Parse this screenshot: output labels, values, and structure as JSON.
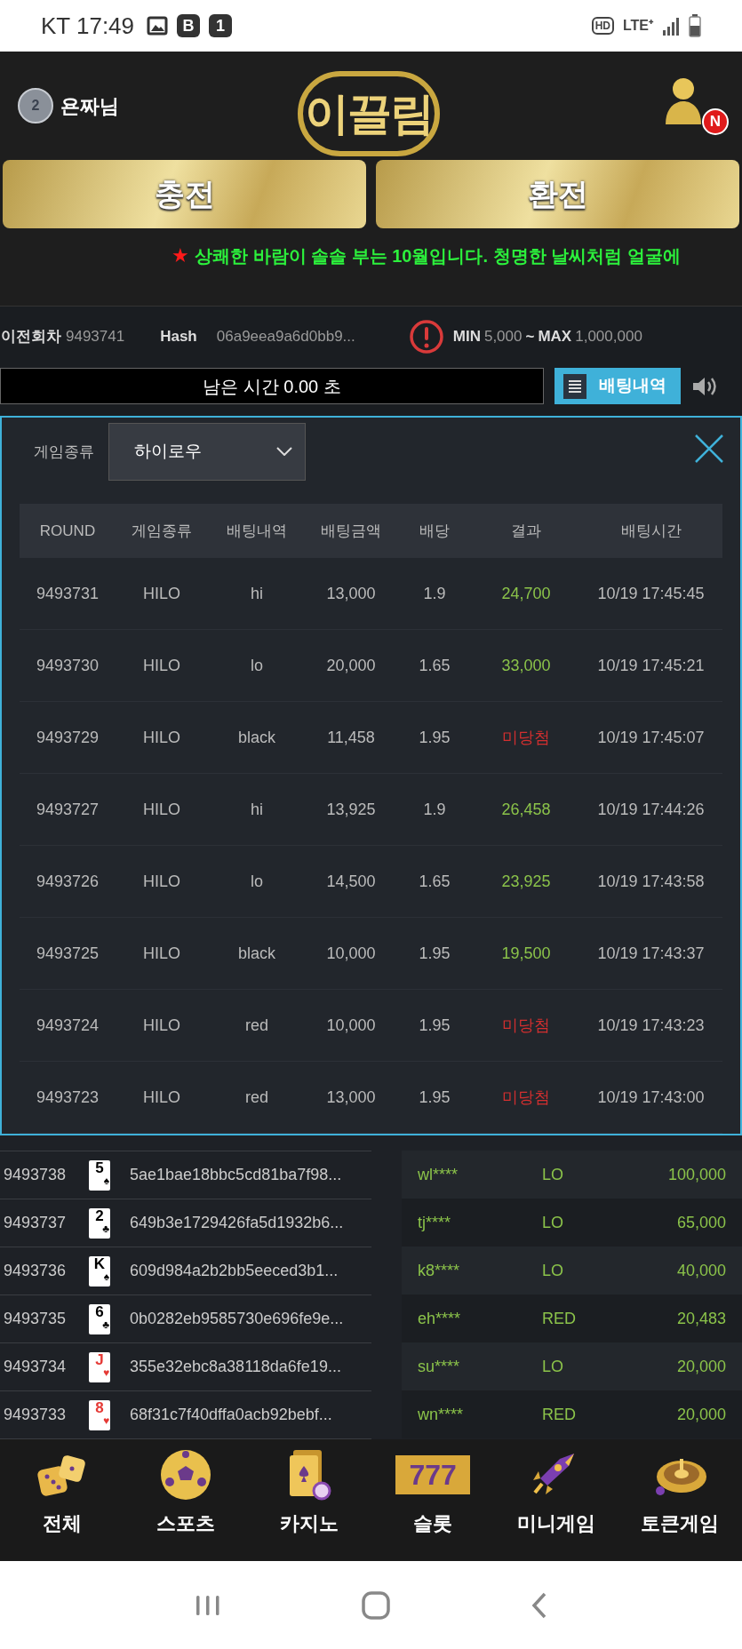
{
  "status_bar": {
    "carrier_time": "KT 17:49",
    "notification_badges": [
      "B",
      "1"
    ],
    "network": "HD",
    "signal_type": "LTE⁺"
  },
  "header": {
    "rank_badge": "2",
    "username": "욘짜님",
    "logo": "이끌림",
    "avatar_badge": "N"
  },
  "actions": [
    "충전",
    "환전"
  ],
  "marquee": {
    "star": "★",
    "text": "상쾌한 바람이 솔솔 부는 10월입니다. 청명한 날씨처럼 얼굴에"
  },
  "info": {
    "prev_label": "이전회차",
    "prev_round": "9493741",
    "hash_label": "Hash",
    "hash": "06a9eea9a6d0bb9...",
    "min_label": "MIN",
    "min": "5,000",
    "sep": "~",
    "max_label": "MAX",
    "max": "1,000,000"
  },
  "timer": "남은 시간 0.00 초",
  "history_button": "배팅내역",
  "modal": {
    "filter_label": "게임종류",
    "filter_value": "하이로우",
    "columns": [
      "ROUND",
      "게임종류",
      "배팅내역",
      "배팅금액",
      "배당",
      "결과",
      "배팅시간"
    ],
    "rows": [
      {
        "round": "9493731",
        "game": "HILO",
        "bet": "hi",
        "amount": "13,000",
        "odds": "1.9",
        "result": "24,700",
        "win": true,
        "time": "10/19 17:45:45"
      },
      {
        "round": "9493730",
        "game": "HILO",
        "bet": "lo",
        "amount": "20,000",
        "odds": "1.65",
        "result": "33,000",
        "win": true,
        "time": "10/19 17:45:21"
      },
      {
        "round": "9493729",
        "game": "HILO",
        "bet": "black",
        "amount": "11,458",
        "odds": "1.95",
        "result": "미당첨",
        "win": false,
        "time": "10/19 17:45:07"
      },
      {
        "round": "9493727",
        "game": "HILO",
        "bet": "hi",
        "amount": "13,925",
        "odds": "1.9",
        "result": "26,458",
        "win": true,
        "time": "10/19 17:44:26"
      },
      {
        "round": "9493726",
        "game": "HILO",
        "bet": "lo",
        "amount": "14,500",
        "odds": "1.65",
        "result": "23,925",
        "win": true,
        "time": "10/19 17:43:58"
      },
      {
        "round": "9493725",
        "game": "HILO",
        "bet": "black",
        "amount": "10,000",
        "odds": "1.95",
        "result": "19,500",
        "win": true,
        "time": "10/19 17:43:37"
      },
      {
        "round": "9493724",
        "game": "HILO",
        "bet": "red",
        "amount": "10,000",
        "odds": "1.95",
        "result": "미당첨",
        "win": false,
        "time": "10/19 17:43:23"
      },
      {
        "round": "9493723",
        "game": "HILO",
        "bet": "red",
        "amount": "13,000",
        "odds": "1.95",
        "result": "미당첨",
        "win": false,
        "time": "10/19 17:43:00"
      }
    ]
  },
  "rounds": [
    {
      "round": "9493738",
      "rank": "5",
      "suit": "♠",
      "color": "#000000",
      "hash": "5ae1bae18bbc5cd81ba7f98..."
    },
    {
      "round": "9493737",
      "rank": "2",
      "suit": "♣",
      "color": "#000000",
      "hash": "649b3e1729426fa5d1932b6..."
    },
    {
      "round": "9493736",
      "rank": "K",
      "suit": "♠",
      "color": "#000000",
      "hash": "609d984a2b2bb5eeced3b1..."
    },
    {
      "round": "9493735",
      "rank": "6",
      "suit": "♣",
      "color": "#000000",
      "hash": "0b0282eb9585730e696fe9e..."
    },
    {
      "round": "9493734",
      "rank": "J",
      "suit": "♥",
      "color": "#e53935",
      "hash": "355e32ebc8a38118da6fe19..."
    },
    {
      "round": "9493733",
      "rank": "8",
      "suit": "♥",
      "color": "#e53935",
      "hash": "68f31c7f40dffa0acb92bebf..."
    }
  ],
  "live_bets": [
    {
      "user": "wl****",
      "pick": "LO",
      "amount": "100,000"
    },
    {
      "user": "tj****",
      "pick": "LO",
      "amount": "65,000"
    },
    {
      "user": "k8****",
      "pick": "LO",
      "amount": "40,000"
    },
    {
      "user": "eh****",
      "pick": "RED",
      "amount": "20,483"
    },
    {
      "user": "su****",
      "pick": "LO",
      "amount": "20,000"
    },
    {
      "user": "wn****",
      "pick": "RED",
      "amount": "20,000"
    }
  ],
  "nav": [
    {
      "kind": "dice",
      "label": "전체"
    },
    {
      "kind": "ball",
      "label": "스포츠"
    },
    {
      "kind": "cards",
      "label": "카지노"
    },
    {
      "kind": "slot",
      "label": "슬롯",
      "icon_text": "777"
    },
    {
      "kind": "rocket",
      "label": "미니게임"
    },
    {
      "kind": "roulette",
      "label": "토큰게임"
    }
  ]
}
